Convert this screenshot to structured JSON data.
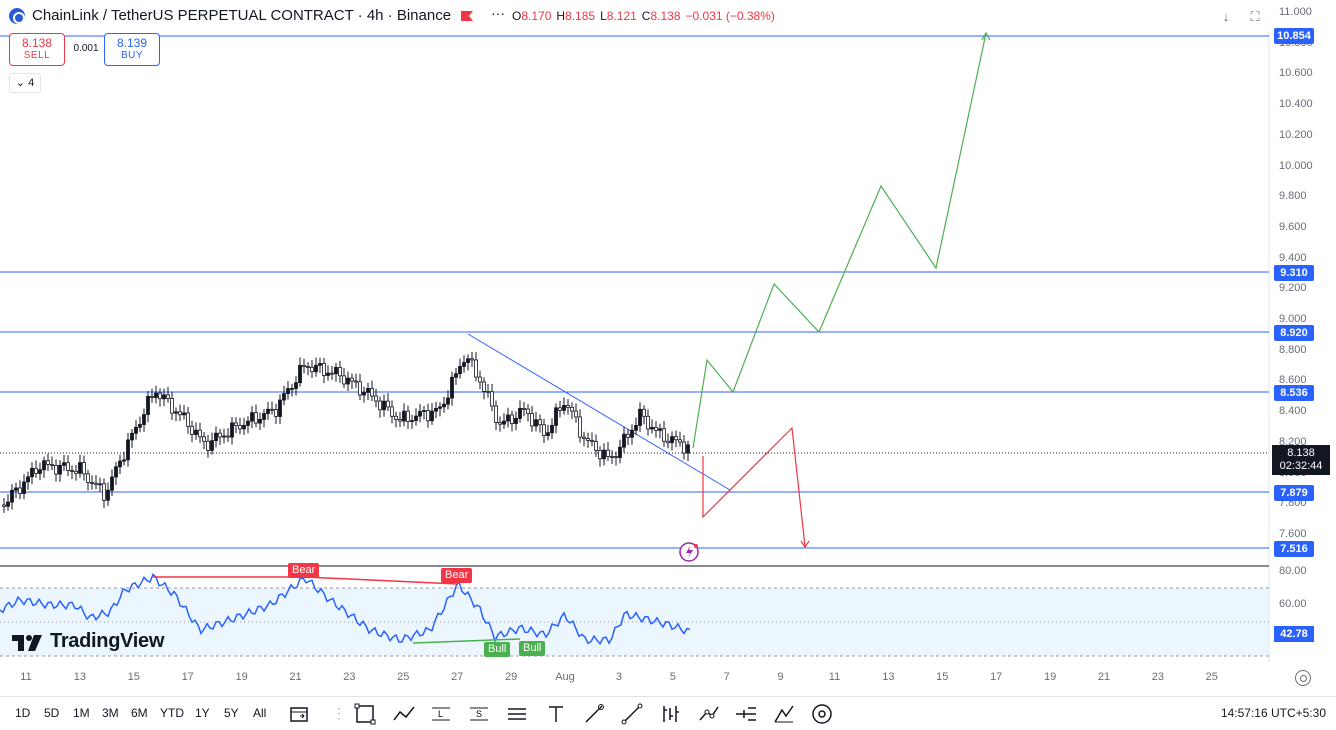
{
  "header": {
    "title": "ChainLink / TetherUS PERPETUAL CONTRACT · 4h · Binance",
    "ohlc": [
      {
        "k": "O",
        "v": "8.170"
      },
      {
        "k": "H",
        "v": "8.185"
      },
      {
        "k": "L",
        "v": "8.121"
      },
      {
        "k": "C",
        "v": "8.138"
      },
      {
        "k": "",
        "v": "−0.031 (−0.38%)"
      }
    ],
    "more_label": "···"
  },
  "trade": {
    "sell_price": "8.138",
    "sell_label": "SELL",
    "spread": "0.001",
    "buy_price": "8.139",
    "buy_label": "BUY",
    "collapse_label": "⌄  4"
  },
  "price_axis": {
    "ticks": [
      "11.000",
      "10.800",
      "10.600",
      "10.400",
      "10.200",
      "10.000",
      "9.800",
      "9.600",
      "9.400",
      "9.200",
      "9.000",
      "8.800",
      "8.600",
      "8.400",
      "8.200",
      "8.000",
      "7.800",
      "7.600"
    ],
    "levels": [
      "10.854",
      "9.310",
      "8.920",
      "8.536",
      "7.879",
      "7.516"
    ],
    "current_price": "8.138",
    "countdown": "02:32:44"
  },
  "rsi": {
    "ticks": [
      "80.00",
      "60.00"
    ],
    "value": "42.78",
    "bear_label": "Bear",
    "bull_label": "Bull"
  },
  "time_axis": {
    "ticks": [
      "11",
      "13",
      "15",
      "17",
      "19",
      "21",
      "23",
      "25",
      "27",
      "29",
      "Aug",
      "3",
      "5",
      "7",
      "9",
      "11",
      "13",
      "15",
      "17",
      "19",
      "21",
      "23",
      "25"
    ]
  },
  "toolbar": {
    "ranges": [
      "1D",
      "5D",
      "1M",
      "3M",
      "6M",
      "YTD",
      "1Y",
      "5Y",
      "All"
    ],
    "clock": "14:57:16 UTC+5:30"
  },
  "logo": {
    "text": "TradingView"
  },
  "colors": {
    "accent": "#2962ff",
    "up": "#089981",
    "down": "#f23645",
    "path_up": "#4caf50"
  }
}
